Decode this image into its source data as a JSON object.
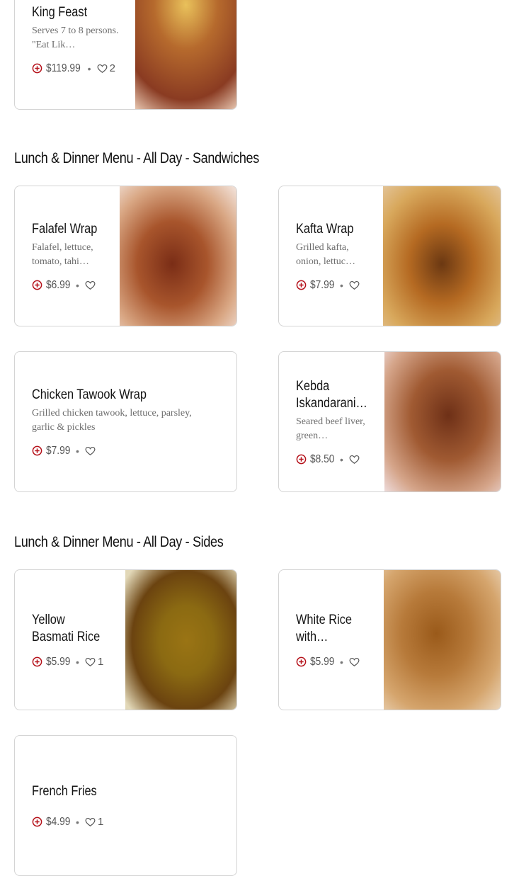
{
  "sections": [
    {
      "title": "Lunch & Dinner Menu - All Day - Sandwiches"
    },
    {
      "title": "Lunch & Dinner Menu - All Day - Sides"
    }
  ],
  "items": {
    "king_feast": {
      "name": "King Feast",
      "description": "Serves 7 to 8 persons. \"Eat Lik…",
      "price": "$119.99",
      "likes": "2"
    },
    "falafel_wrap": {
      "name": "Falafel Wrap",
      "description": "Falafel, lettuce, tomato, tahi…",
      "price": "$6.99",
      "likes": ""
    },
    "kafta_wrap": {
      "name": "Kafta Wrap",
      "description": "Grilled kafta, onion, lettuc…",
      "price": "$7.99",
      "likes": ""
    },
    "chicken_tawook_wrap": {
      "name": "Chicken Tawook Wrap",
      "description": "Grilled chicken tawook, lettuce, parsley, garlic & pickles",
      "price": "$7.99",
      "likes": ""
    },
    "kebda_iskandarani": {
      "name_line1": "Kebda",
      "name_line2": "Iskandarani…",
      "description": "Seared beef liver, green…",
      "price": "$8.50",
      "likes": ""
    },
    "yellow_basmati_rice": {
      "name_line1": "Yellow",
      "name_line2": "Basmati Rice",
      "price": "$5.99",
      "likes": "1"
    },
    "white_rice": {
      "name_line1": "White Rice",
      "name_line2": "with…",
      "price": "$5.99",
      "likes": ""
    },
    "french_fries": {
      "name": "French Fries",
      "price": "$4.99",
      "likes": "1"
    }
  },
  "icons": {
    "add": "plus-circle-icon",
    "like": "heart-icon"
  },
  "colors": {
    "accent": "#b5121b",
    "border": "#d4d4d4",
    "text": "#141414",
    "muted": "#6e6e6e"
  }
}
